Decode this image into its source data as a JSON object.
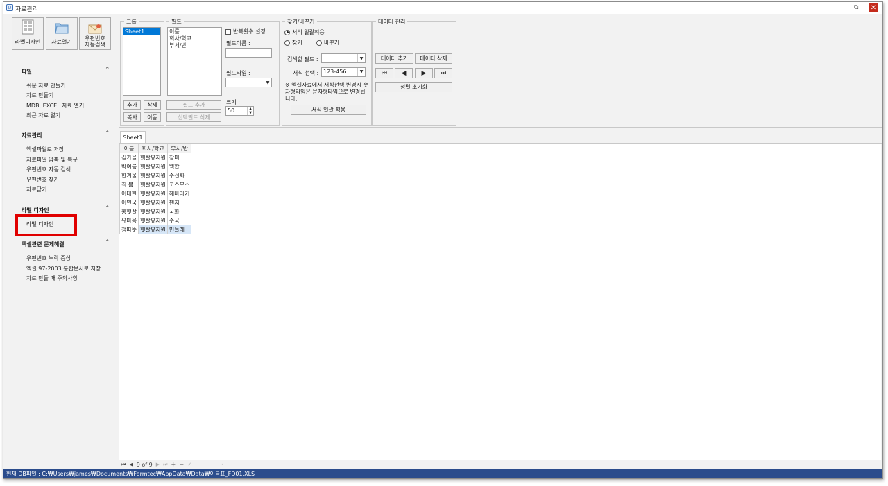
{
  "window": {
    "title": "자료관리"
  },
  "toolbar": {
    "label_design": "라벨디자인",
    "open_data": "자료열기",
    "postal_line1": "우편번호",
    "postal_line2": "자동검색"
  },
  "sidebar": {
    "sections": [
      {
        "title": "파일",
        "items": [
          "쉬운 자료 만들기",
          "자료 만들기",
          "MDB, EXCEL 자료 열기",
          "최근 자료 열기"
        ]
      },
      {
        "title": "자료관리",
        "items": [
          "엑셀파일로 저장",
          "자료파일 압축 및 복구",
          "우편번호 자동 검색",
          "우편번호 찾기",
          "자료닫기"
        ]
      },
      {
        "title": "라벨 디자인",
        "items": [
          "라벨 디자인"
        ]
      },
      {
        "title": "엑셀관련 문제해결",
        "items": [
          "우편번호 누락 증상",
          "엑셀 97-2003 통합문서로 저장",
          "자료 만들 때 주의사항"
        ]
      }
    ]
  },
  "group_box": {
    "label": "그룹",
    "sheets": [
      "Sheet1"
    ],
    "add": "추가",
    "delete": "삭제",
    "copy": "복사",
    "move": "이동"
  },
  "field_box": {
    "label": "필드",
    "fields": [
      "이름",
      "회사/학교",
      "부서/반"
    ],
    "repeat_label": "반복횟수 설정",
    "name_label": "필드이름 :",
    "type_label": "필드타입 :",
    "size_label": "크기 :",
    "size_value": "50",
    "add_field": "필드 추가",
    "delete_field": "선택필드 삭제"
  },
  "find_box": {
    "label": "찾기/바꾸기",
    "opt_format": "서식 일괄적용",
    "opt_find": "찾기",
    "opt_replace": "바꾸기",
    "search_field_label": "검색할 필드 :",
    "format_label": "서식 선택 :",
    "format_value": "123-456",
    "note": "※ 엑셀자료에서 서식선택 변경시 숫자형타입은 문자형타입으로 변경됩니다.",
    "apply": "서식 일괄 적용"
  },
  "data_box": {
    "label": "데이터 관리",
    "add": "데이터 추가",
    "delete": "데이터 삭제",
    "reset_sort": "정렬 초기화"
  },
  "sheet_tab": "Sheet1",
  "grid": {
    "headers": [
      "이름",
      "회사/학교",
      "부서/반"
    ],
    "rows": [
      [
        "김가을",
        "햇살유치원",
        "장미"
      ],
      [
        "박여름",
        "햇살유치원",
        "백합"
      ],
      [
        "한겨울",
        "햇살유치원",
        "수선화"
      ],
      [
        "최 봄",
        "햇살유치원",
        "코스모스"
      ],
      [
        "이대한",
        "햇살유치원",
        "해바라기"
      ],
      [
        "이민국",
        "햇살유치원",
        "팬지"
      ],
      [
        "홍햇살",
        "햇살유치원",
        "국화"
      ],
      [
        "유마음",
        "햇살유치원",
        "수국"
      ],
      [
        "정따뜻",
        "햇살유치원",
        "민들레"
      ]
    ]
  },
  "navigator": {
    "position": "9 of 9"
  },
  "status": {
    "text": "현재 DB파일 : C:₩Users₩james₩Documents₩Formtec₩AppData₩Data₩이름표_FD01.XLS"
  },
  "colors": {
    "highlight_box": "#e00000",
    "status_bar": "#2b4c8c",
    "list_selection": "#0078d7"
  }
}
